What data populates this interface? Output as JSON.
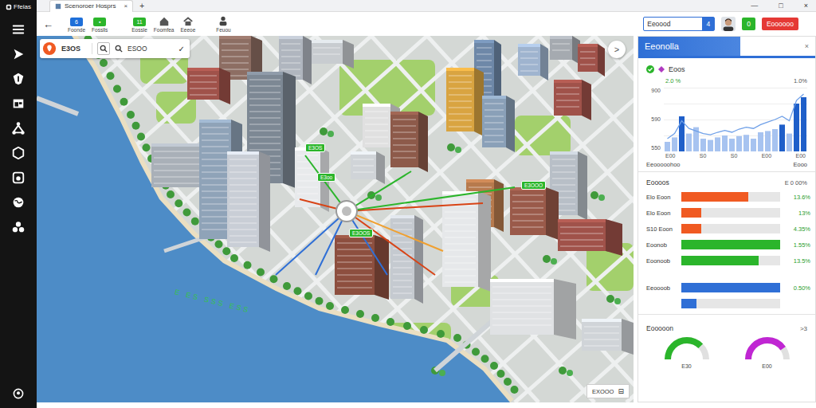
{
  "window": {
    "title": "Ffeias",
    "controls": [
      "—",
      "□",
      "×"
    ]
  },
  "browser": {
    "tab": {
      "title": "Scenoroer Hosprs",
      "close": "×",
      "selected": true
    },
    "new_tab": "+"
  },
  "toolbar": {
    "back": "←",
    "tools": [
      {
        "label": "Foonde",
        "badge": "6",
        "color": "#1e6fd9"
      },
      {
        "label": "Fosslls",
        "badge": "▪",
        "color": "#2bb52b"
      },
      {
        "label": "Eossle",
        "badge": "11",
        "color": "#2bb52b"
      },
      {
        "label": "Foomfea"
      },
      {
        "label": "Eeeoe"
      },
      {
        "label": "Feuou"
      }
    ],
    "search": {
      "value": "Eeoood",
      "count": "4"
    },
    "buttons": [
      {
        "label": "0",
        "color": "#2bb52b"
      },
      {
        "label": "Eoooooo",
        "color": "#e53935"
      }
    ]
  },
  "map": {
    "search": {
      "value": "E3OS",
      "query": "ESOO",
      "confirm": "✓"
    },
    "next": ">",
    "tags": [
      "E3OS",
      "E3oo",
      "E3OOS",
      "E3OOO"
    ],
    "water_label": "E ES SSS ESS",
    "legend": {
      "label": "EXOOO",
      "icon": "⊟"
    }
  },
  "panel": {
    "title": "Eeonolla",
    "close": "×",
    "metric": {
      "label": "Eoos",
      "change": "2.0 %",
      "secondary": "1.0%"
    },
    "chart": {
      "y_ticks": [
        "900",
        "590",
        "550"
      ],
      "x_ticks": [
        "E00",
        "S0",
        "S0",
        "E00",
        "E00"
      ],
      "max": 100,
      "bars": [
        15,
        22,
        55,
        28,
        38,
        20,
        18,
        22,
        25,
        20,
        24,
        26,
        20,
        30,
        32,
        35,
        42,
        28,
        75,
        85
      ],
      "line": [
        20,
        28,
        48,
        36,
        32,
        28,
        26,
        30,
        33,
        30,
        35,
        38,
        36,
        42,
        46,
        50,
        55,
        48,
        80,
        90
      ]
    },
    "chart_caption": {
      "left": "Eeooooohoo",
      "right": "Eooo"
    },
    "breakdown": {
      "title": "Eoooos",
      "total": "E 0 00%",
      "groups": [
        {
          "rows": [
            {
              "label": "Elo Eoon",
              "value": "13.6%",
              "level": 0.68,
              "color": "#f05a22"
            },
            {
              "label": "Elo Eoon",
              "value": "13%",
              "level": 0.2,
              "color": "#f05a22"
            },
            {
              "label": "S10 Eoon",
              "value": "4.35%",
              "level": 0.2,
              "color": "#f05a22"
            },
            {
              "label": "Eoonob",
              "value": "1.55%",
              "level": 1.0,
              "color": "#2bb52b"
            },
            {
              "label": "Eoonoob",
              "value": "13.5%",
              "level": 0.78,
              "color": "#2bb52b"
            }
          ]
        },
        {
          "rows": [
            {
              "label": "Eeoooob",
              "value": "0.50%",
              "level": 1.0,
              "color": "#2f6fd6"
            },
            {
              "level": 0.15,
              "color": "#2f6fd6"
            }
          ]
        }
      ]
    },
    "gauges": {
      "title": "Eooooon",
      "more": ">3",
      "items": [
        {
          "label": "E30",
          "level": 0.75,
          "color": "#2bb52b"
        },
        {
          "label": "E00",
          "level": 0.8,
          "color": "#c026d3"
        }
      ]
    }
  }
}
